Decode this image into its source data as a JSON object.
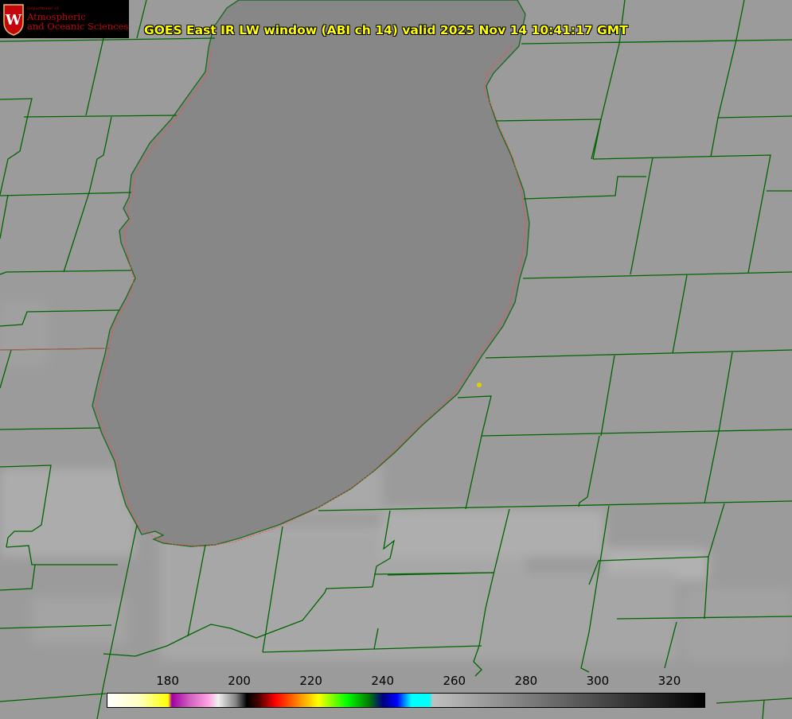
{
  "header": {
    "title": "GOES East IR LW window (ABI ch 14) valid 2025 Nov 14 10:41:17 GMT"
  },
  "logo": {
    "small_text": "Department of",
    "line1": "Atmospheric",
    "line2": "and Oceanic Sciences",
    "crest_letter": "W",
    "icon": "uw-crest-icon"
  },
  "colorbar": {
    "ticks": [
      "180",
      "200",
      "220",
      "240",
      "260",
      "280",
      "300",
      "320"
    ],
    "range": [
      163,
      330
    ]
  },
  "colors": {
    "county_lines": "#006400",
    "coastline": "#ff4a4a",
    "lake": "#888888",
    "land": "#9a9a9a",
    "title_text": "#ffff00",
    "logo_text": "#c5050c",
    "marker": "#e0d000"
  }
}
